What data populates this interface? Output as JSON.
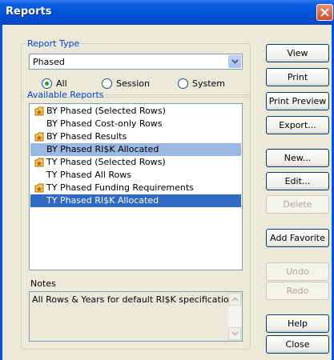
{
  "window": {
    "title": "Reports"
  },
  "report_type": {
    "legend": "Report Type",
    "selected": "Phased",
    "radios": [
      {
        "label": "All",
        "checked": true
      },
      {
        "label": "Session",
        "checked": false
      },
      {
        "label": "System",
        "checked": false
      }
    ]
  },
  "available_reports": {
    "legend": "Available Reports",
    "items": [
      {
        "label": "BY Phased (Selected Rows)",
        "favorite": true,
        "state": "none"
      },
      {
        "label": "BY Phased Cost-only Rows",
        "favorite": false,
        "state": "none"
      },
      {
        "label": "BY Phased Results",
        "favorite": true,
        "state": "none"
      },
      {
        "label": "BY Phased RI$K Allocated",
        "favorite": false,
        "state": "light"
      },
      {
        "label": "TY Phased (Selected Rows)",
        "favorite": true,
        "state": "none"
      },
      {
        "label": "TY Phased All Rows",
        "favorite": false,
        "state": "none"
      },
      {
        "label": "TY Phased Funding Requirements",
        "favorite": true,
        "state": "none"
      },
      {
        "label": "TY Phased RI$K Allocated",
        "favorite": false,
        "state": "dark"
      }
    ]
  },
  "notes": {
    "label": "Notes",
    "text": "All Rows & Years for default RI$K specifications"
  },
  "buttons": {
    "view": "View",
    "print": "Print",
    "print_preview": "Print Preview",
    "export": "Export...",
    "new": "New...",
    "edit": "Edit...",
    "delete": "Delete",
    "add_favorite": "Add Favorite",
    "undo": "Undo",
    "redo": "Redo",
    "help": "Help",
    "close": "Close"
  },
  "colors": {
    "title_bar": "#0052d6",
    "legend_text": "#0046d5",
    "selection_dark": "#316ac5",
    "selection_light": "#9bb8e3",
    "radio_dot": "#21a121",
    "close_button": "#d44a22"
  }
}
